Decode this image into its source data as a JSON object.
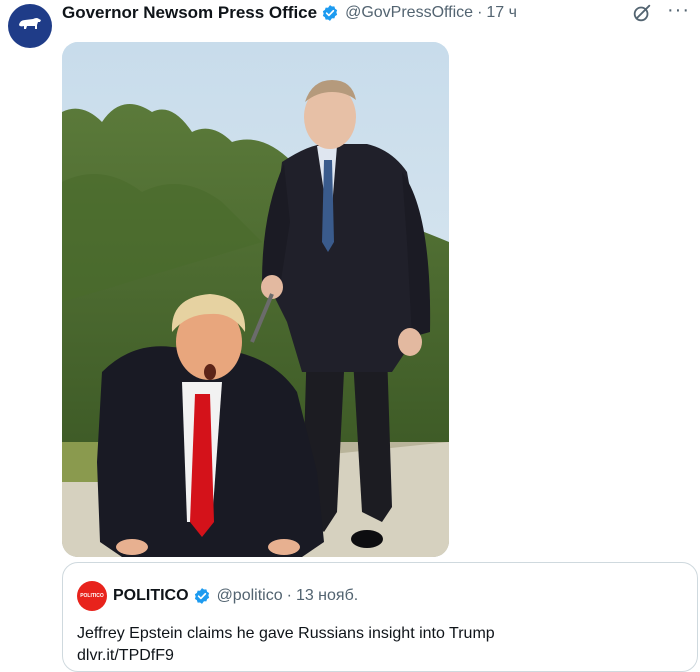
{
  "tweet": {
    "display_name": "Governor Newsom Press Office",
    "handle": "@GovPressOffice",
    "separator": "·",
    "time": "17 ч",
    "avatar_icon": "bear-icon",
    "verified_icon": "verified-badge-icon",
    "more_label": "···"
  },
  "quoted_tweet": {
    "display_name": "POLITICO",
    "avatar_label": "POLITICO",
    "handle": "@politico",
    "separator": "·",
    "time": "13 нояб.",
    "text_line1": "Jeffrey Epstein claims he gave Russians insight into Trump",
    "text_line2": "dlvr.it/TPDfF9"
  },
  "colors": {
    "brand_blue": "#1d9bf0",
    "politico_red": "#e8231c",
    "secondary_text": "#536471",
    "border": "#cfd9de"
  }
}
